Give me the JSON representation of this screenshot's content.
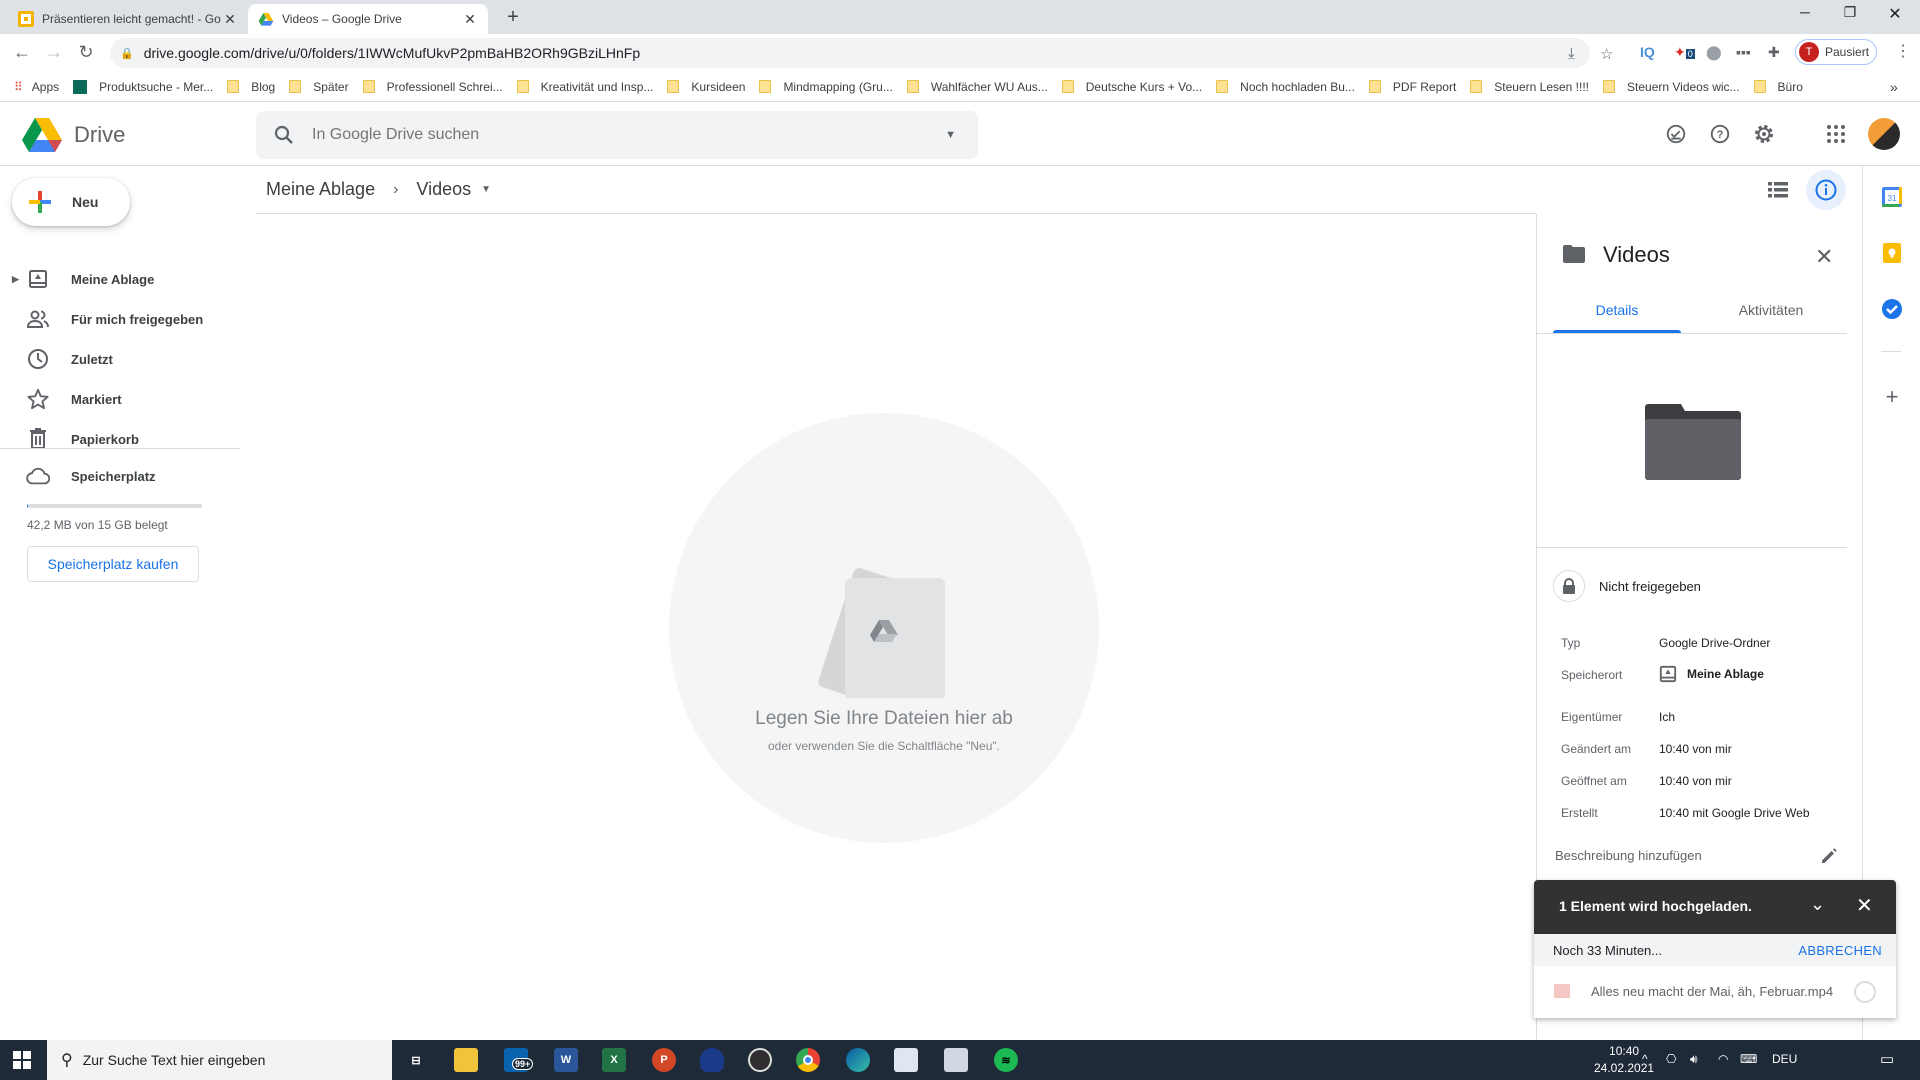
{
  "browser": {
    "tabs": [
      {
        "title": "Präsentieren leicht gemacht! - Go",
        "icon": "slides-icon",
        "active": false
      },
      {
        "title": "Videos – Google Drive",
        "icon": "drive-icon",
        "active": true
      }
    ],
    "new_tab_label": "+",
    "url": "drive.google.com/drive/u/0/folders/1IWWcMufUkvP2pmBaHB2ORh9GBziLHnFp",
    "profile_initial": "T",
    "profile_status": "Pausiert",
    "extensions": [
      "IQ",
      "0"
    ],
    "bookmarks": [
      {
        "label": "Apps",
        "icon": "apps-grid-icon"
      },
      {
        "label": "Produktsuche - Mer...",
        "icon": "site-icon"
      },
      {
        "label": "Blog",
        "icon": "folder-icon"
      },
      {
        "label": "Später",
        "icon": "folder-icon"
      },
      {
        "label": "Professionell Schrei...",
        "icon": "folder-icon"
      },
      {
        "label": "Kreativität und Insp...",
        "icon": "folder-icon"
      },
      {
        "label": "Kursideen",
        "icon": "folder-icon"
      },
      {
        "label": "Mindmapping (Gru...",
        "icon": "folder-icon"
      },
      {
        "label": "Wahlfächer WU Aus...",
        "icon": "folder-icon"
      },
      {
        "label": "Deutsche Kurs + Vo...",
        "icon": "folder-icon"
      },
      {
        "label": "Noch hochladen Bu...",
        "icon": "folder-icon"
      },
      {
        "label": "PDF Report",
        "icon": "folder-icon"
      },
      {
        "label": "Steuern Lesen !!!!",
        "icon": "folder-icon"
      },
      {
        "label": "Steuern Videos wic...",
        "icon": "folder-icon"
      },
      {
        "label": "Büro",
        "icon": "folder-icon"
      }
    ],
    "bookmarks_overflow": "»"
  },
  "drive": {
    "logo_text": "Drive",
    "search_placeholder": "In Google Drive suchen",
    "new_button": "Neu",
    "nav": [
      {
        "label": "Meine Ablage",
        "icon": "my-drive-icon"
      },
      {
        "label": "Für mich freigegeben",
        "icon": "shared-icon"
      },
      {
        "label": "Zuletzt",
        "icon": "clock-icon"
      },
      {
        "label": "Markiert",
        "icon": "star-icon"
      },
      {
        "label": "Papierkorb",
        "icon": "trash-icon"
      }
    ],
    "storage": {
      "label": "Speicherplatz",
      "used_text": "42,2 MB von 15 GB belegt",
      "used_fraction": 0.003,
      "buy_button": "Speicherplatz kaufen"
    },
    "breadcrumb": [
      {
        "label": "Meine Ablage"
      },
      {
        "label": "Videos"
      }
    ],
    "breadcrumb_separator": "›",
    "empty_state": {
      "title": "Legen Sie Ihre Dateien hier ab",
      "subtitle": "oder verwenden Sie die Schaltfläche \"Neu\"."
    }
  },
  "details_panel": {
    "title": "Videos",
    "tabs": [
      "Details",
      "Aktivitäten"
    ],
    "active_tab": "Details",
    "sharing": "Nicht freigegeben",
    "properties": [
      {
        "key": "Typ",
        "value": "Google Drive-Ordner"
      },
      {
        "key": "Speicherort",
        "value": "Meine Ablage"
      },
      {
        "key": "Eigentümer",
        "value": "Ich"
      },
      {
        "key": "Geändert am",
        "value": "10:40 von mir"
      },
      {
        "key": "Geöffnet am",
        "value": "10:40 von mir"
      },
      {
        "key": "Erstellt",
        "value": "10:40 mit Google Drive Web"
      }
    ],
    "description_placeholder": "Beschreibung hinzufügen"
  },
  "upload": {
    "title": "1 Element wird hochgeladen.",
    "remaining": "Noch 33 Minuten...",
    "cancel": "ABBRECHEN",
    "file_name": "Alles neu macht der Mai, äh, Februar.mp4"
  },
  "taskbar": {
    "search_placeholder": "Zur Suche Text hier eingeben",
    "mail_badge": "99+",
    "language": "DEU",
    "time": "10:40",
    "date": "24.02.2021"
  },
  "colors": {
    "accent": "#1a73e8",
    "toast_bg": "#323232",
    "taskbar_bg": "#1e2a38"
  }
}
